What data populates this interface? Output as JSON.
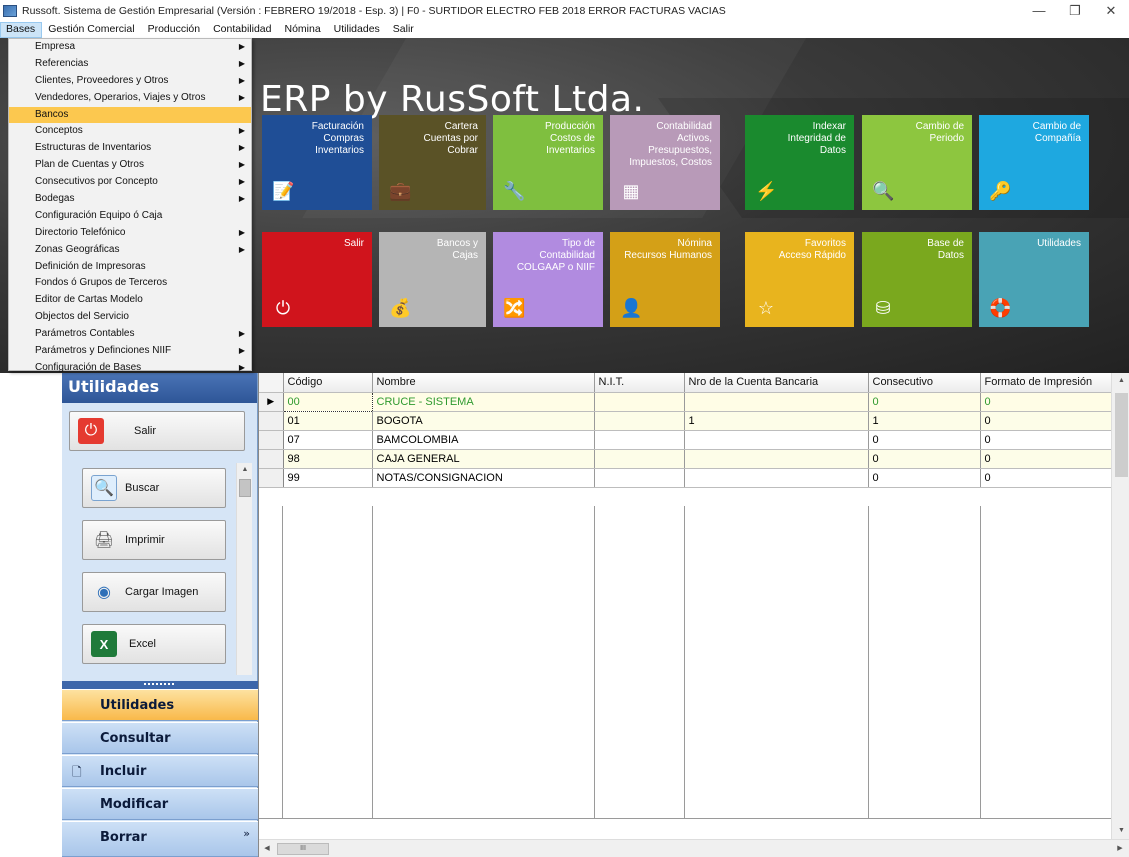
{
  "window": {
    "title": "Russoft. Sistema de Gestión Empresarial (Versión : FEBRERO 19/2018 - Esp. 3) | F0 - SURTIDOR ELECTRO FEB 2018 ERROR FACTURAS VACIAS",
    "minimize": "—",
    "restore": "❐",
    "close": "✕"
  },
  "menubar": [
    "Bases",
    "Gestión Comercial",
    "Producción",
    "Contabilidad",
    "Nómina",
    "Utilidades",
    "Salir"
  ],
  "dropdown": [
    {
      "label": "Empresa",
      "arrow": true
    },
    {
      "label": "Referencias",
      "arrow": true
    },
    {
      "label": "Clientes, Proveedores y Otros",
      "arrow": true
    },
    {
      "label": "Vendedores, Operarios, Viajes y Otros",
      "arrow": true
    },
    {
      "label": "Bancos",
      "arrow": false,
      "highlighted": true
    },
    {
      "label": "Conceptos",
      "arrow": true
    },
    {
      "label": "Estructuras de Inventarios",
      "arrow": true
    },
    {
      "label": "Plan de Cuentas y Otros",
      "arrow": true
    },
    {
      "label": "Consecutivos por Concepto",
      "arrow": true
    },
    {
      "label": "Bodegas",
      "arrow": true
    },
    {
      "label": "Configuración  Equipo ó Caja",
      "arrow": false
    },
    {
      "label": "Directorio Telefónico",
      "arrow": true
    },
    {
      "label": "Zonas Geográficas",
      "arrow": true
    },
    {
      "label": "Definición de Impresoras",
      "arrow": false
    },
    {
      "label": "Fondos ó Grupos de Terceros",
      "arrow": false
    },
    {
      "label": "Editor de Cartas Modelo",
      "arrow": false
    },
    {
      "label": "Objectos del Servicio",
      "arrow": false
    },
    {
      "label": "Parámetros Contables",
      "arrow": true
    },
    {
      "label": "Parámetros y Definciones NIIF",
      "arrow": true
    },
    {
      "label": "Configuración de Bases",
      "arrow": true
    }
  ],
  "hero": {
    "title": "ERP by RusSoft Ltda."
  },
  "tiles": [
    {
      "label": "Facturación\nCompras\nInventarios",
      "color": "#1f4e96",
      "icon": "📝"
    },
    {
      "label": "Cartera\nCuentas por\nCobrar",
      "color": "#5a5226",
      "icon": "💼"
    },
    {
      "label": "Producción\nCostos de\nInventarios",
      "color": "#7fbf3f",
      "icon": "🔧"
    },
    {
      "label": "Contabilidad\nActivos,\nPresupuestos,\nImpuestos, Costos",
      "color": "#b89ab8",
      "icon": "▦"
    },
    {
      "label": "Indexar\nIntegridad de\nDatos",
      "color": "#1a8a2e",
      "icon": "⚡"
    },
    {
      "label": "Cambio de\nPeriodo",
      "color": "#8dc63f",
      "icon": "🔍"
    },
    {
      "label": "Cambio de\nCompañía",
      "color": "#1ea8e0",
      "icon": "🔑"
    },
    {
      "label": "Salir",
      "color": "#d0141c",
      "icon": "⏻"
    },
    {
      "label": "Bancos y\nCajas",
      "color": "#b5b5b5",
      "icon": "💰"
    },
    {
      "label": "Tipo de\nContabilidad\nCOLGAAP o NIIF",
      "color": "#b18be0",
      "icon": "🔀"
    },
    {
      "label": "Nómina\nRecursos Humanos",
      "color": "#d4a017",
      "icon": "👤"
    },
    {
      "label": "Favoritos\nAcceso Rápido",
      "color": "#e8b41e",
      "icon": "☆"
    },
    {
      "label": "Base de\nDatos",
      "color": "#7aa81e",
      "icon": "⛁"
    },
    {
      "label": "Utilidades",
      "color": "#49a3b5",
      "icon": "🛟"
    }
  ],
  "sidebar": {
    "header": "Utilidades",
    "buttons": [
      {
        "label": "Salir",
        "icon": "⏻"
      },
      {
        "label": "Buscar",
        "icon": "🔍"
      },
      {
        "label": "Imprimir",
        "icon": "🖨"
      },
      {
        "label": "Cargar Imagen",
        "icon": "◉"
      },
      {
        "label": "Excel",
        "icon": "X"
      }
    ],
    "nav": [
      {
        "label": "Utilidades",
        "active": true,
        "icon": ""
      },
      {
        "label": "Consultar",
        "active": false,
        "icon": ""
      },
      {
        "label": "Incluir",
        "active": false,
        "icon": "🗋"
      },
      {
        "label": "Modificar",
        "active": false,
        "icon": ""
      },
      {
        "label": "Borrar",
        "active": false,
        "icon": ""
      }
    ],
    "more_glyph": "»"
  },
  "grid": {
    "columns": [
      "Código",
      "Nombre",
      "N.I.T.",
      "Nro de la Cuenta Bancaria",
      "Consecutivo",
      "Formato de Impresión"
    ],
    "rows": [
      [
        "00",
        "CRUCE - SISTEMA",
        "",
        "",
        "0",
        "0"
      ],
      [
        "01",
        "BOGOTA",
        "",
        "1",
        "1",
        "0"
      ],
      [
        "07",
        "BAMCOLOMBIA",
        "",
        "",
        "0",
        "0"
      ],
      [
        "98",
        "CAJA GENERAL",
        "",
        "",
        "0",
        "0"
      ],
      [
        "99",
        "NOTAS/CONSIGNACION",
        "",
        "",
        "0",
        "0"
      ]
    ],
    "current_row_marker": "▶",
    "hscroll_thumb": "III"
  }
}
